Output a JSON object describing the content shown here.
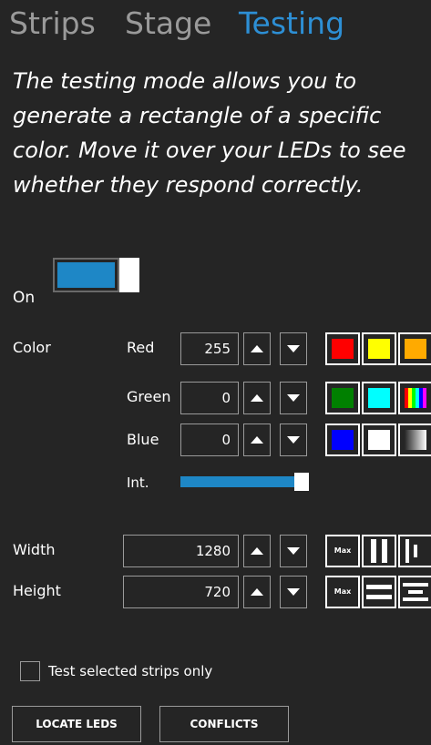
{
  "tabs": [
    {
      "label": "Strips"
    },
    {
      "label": "Stage"
    },
    {
      "label": "Testing"
    }
  ],
  "description": "The testing mode allows you to generate a rectangle of a specific color. Move it over your LEDs to see whether they respond correctly.",
  "toggle": {
    "label": "On",
    "state": true,
    "color": "#1e87c6"
  },
  "color": {
    "label": "Color",
    "red": {
      "label": "Red",
      "value": "255"
    },
    "green": {
      "label": "Green",
      "value": "0"
    },
    "blue": {
      "label": "Blue",
      "value": "0"
    },
    "intensity": {
      "label": "Int.",
      "level": 1.0
    }
  },
  "swatches": [
    {
      "name": "red",
      "color": "#ff0000"
    },
    {
      "name": "yellow",
      "color": "#ffff00"
    },
    {
      "name": "orange",
      "color": "#ffaa00"
    },
    {
      "name": "green",
      "color": "#008000"
    },
    {
      "name": "cyan",
      "color": "#00ffff"
    },
    {
      "name": "rainbow",
      "color": "multicolor"
    },
    {
      "name": "blue",
      "color": "#0000ff"
    },
    {
      "name": "white",
      "color": "#ffffff"
    },
    {
      "name": "gradient",
      "color": "gradient"
    }
  ],
  "dimensions": {
    "width": {
      "label": "Width",
      "value": "1280",
      "max_label": "Max"
    },
    "height": {
      "label": "Height",
      "value": "720",
      "max_label": "Max"
    }
  },
  "test_selected": {
    "label": "Test selected strips only",
    "checked": false
  },
  "buttons": {
    "locate": "LOCATE LEDS",
    "conflicts": "CONFLICTS"
  }
}
